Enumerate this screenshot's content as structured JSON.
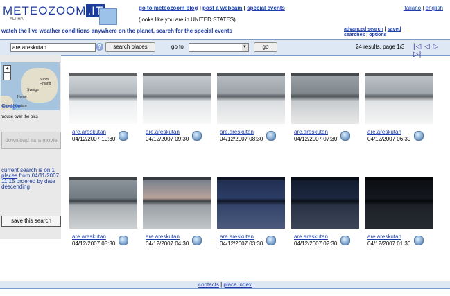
{
  "header": {
    "logo": "METEOZOOM",
    "logo_suffix": ".IT",
    "logo_sub": "ALPHA",
    "blog_link": "go to meteozoom blog",
    "webcam_link": "post a webcam",
    "events_link": "special events",
    "separator": "|",
    "location_note": "(looks like you are in UNITED STATES)",
    "lang_italian": "italiano",
    "lang_english": "english",
    "tagline": "watch the live weather conditions anywhere on the planet, search for the special events",
    "advanced_search": "advanced search",
    "saved_searches": "saved searches",
    "options": "options"
  },
  "search": {
    "value": "are.areskutan",
    "help": "?",
    "button": "search places",
    "goto_label": "go to",
    "goto_button": "go",
    "results_text": "24 results,",
    "page_text": "page 1/3",
    "nav_first": "|◁",
    "nav_prev": "◁",
    "nav_next": "▷",
    "nav_last": "▷|"
  },
  "sidebar": {
    "zoom_in": "+",
    "zoom_out": "−",
    "map_labels": [
      "Suomi Finland",
      "Sverige",
      "Norge",
      "United Kingdom"
    ],
    "map_brand": "Google",
    "mouse_note": "mouse over the pics",
    "download_button": "download as a movie",
    "current_prefix": "current search is",
    "current_link": "on 1 places",
    "current_suffix": "from 04/11/2007 11:15 ordered by date descending",
    "save_button": "save this search"
  },
  "thumbnails": [
    {
      "name": "are.areskutan",
      "date": "04/12/2007 10:30"
    },
    {
      "name": "are.areskutan",
      "date": "04/12/2007 09:30"
    },
    {
      "name": "are.areskutan",
      "date": "04/12/2007 08:30"
    },
    {
      "name": "are.areskutan",
      "date": "04/12/2007 07:30"
    },
    {
      "name": "are.areskutan",
      "date": "04/12/2007 06:30"
    },
    {
      "name": "are.areskutan",
      "date": "04/12/2007 05:30"
    },
    {
      "name": "are.areskutan",
      "date": "04/12/2007 04:30"
    },
    {
      "name": "are.areskutan",
      "date": "04/12/2007 03:30"
    },
    {
      "name": "are.areskutan",
      "date": "04/12/2007 02:30"
    },
    {
      "name": "are.areskutan",
      "date": "04/12/2007 01:30"
    }
  ],
  "footer": {
    "contacts": "contacts",
    "place_index": "place index",
    "separator": "|"
  },
  "colors": {
    "brand": "#1c3c9c",
    "bar_bg": "#dde8f4",
    "link": "#1f3fb0"
  },
  "icons": {
    "help": "help-icon",
    "globe": "globe-icon",
    "page_nav": "arrow-icons"
  }
}
